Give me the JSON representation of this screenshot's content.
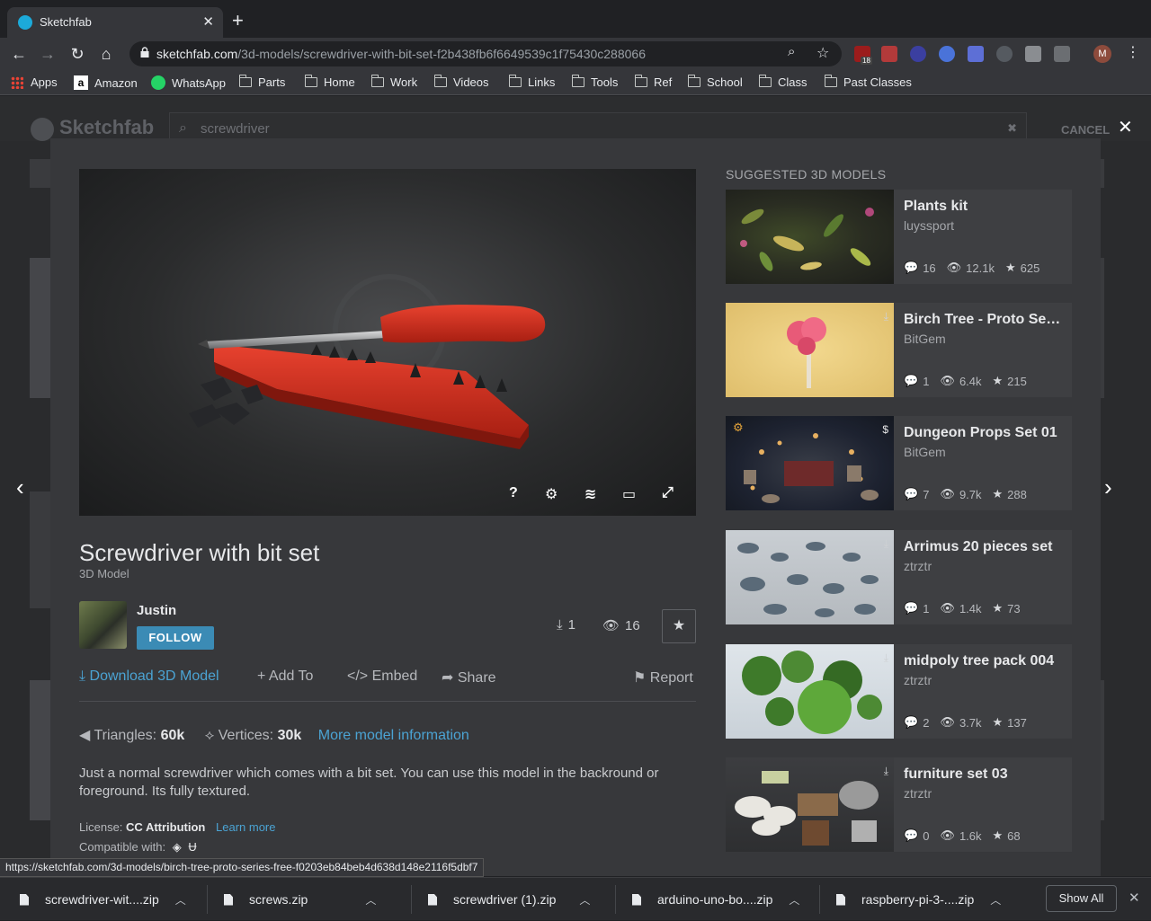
{
  "browser": {
    "tab_title": "Sketchfab",
    "tab_close": "✕",
    "new_tab": "+",
    "url_host": "sketchfab.com",
    "url_path": "/3d-models/screwdriver-with-bit-set-f2b438fb6f6649539c1f75430c288066",
    "profile_initial": "M",
    "ext_badge": "18",
    "bookmarks": [
      "Apps",
      "Amazon",
      "WhatsApp",
      "Parts",
      "Home",
      "Work",
      "Videos",
      "Links",
      "Tools",
      "Ref",
      "School",
      "Class",
      "Past Classes"
    ]
  },
  "background_page": {
    "logo": "Sketchfab",
    "search_value": "screwdriver",
    "cancel": "CANCEL"
  },
  "model": {
    "title": "Screwdriver with bit set",
    "subtitle": "3D Model",
    "author": "Justin",
    "follow": "FOLLOW",
    "downloads": "1",
    "views": "16",
    "actions": {
      "download": "Download 3D Model",
      "add_to": "Add To",
      "embed": "Embed",
      "share": "Share",
      "report": "Report"
    },
    "triangles_label": "Triangles:",
    "triangles": "60k",
    "vertices_label": "Vertices:",
    "vertices": "30k",
    "more_info": "More model information",
    "description": "Just a normal screwdriver which comes with a bit set. You can use this model in the backround or foreground. Its fully textured.",
    "license_label": "License:",
    "license": "CC Attribution",
    "learn_more": "Learn more",
    "compatible_label": "Compatible with:"
  },
  "viewer_controls": [
    "?",
    "⚙",
    "≋",
    "▭",
    "⤢"
  ],
  "suggested": {
    "heading": "SUGGESTED 3D MODELS",
    "items": [
      {
        "name": "Plants kit",
        "author": "luyssport",
        "comments": "16",
        "views": "12.1k",
        "likes": "625"
      },
      {
        "name": "Birch Tree - Proto Seri...",
        "author": "BitGem",
        "comments": "1",
        "views": "6.4k",
        "likes": "215"
      },
      {
        "name": "Dungeon Props Set 01",
        "author": "BitGem",
        "comments": "7",
        "views": "9.7k",
        "likes": "288"
      },
      {
        "name": "Arrimus 20 pieces set",
        "author": "ztrztr",
        "comments": "1",
        "views": "1.4k",
        "likes": "73"
      },
      {
        "name": "midpoly tree pack 004",
        "author": "ztrztr",
        "comments": "2",
        "views": "3.7k",
        "likes": "137"
      },
      {
        "name": "furniture set 03",
        "author": "ztrztr",
        "comments": "0",
        "views": "1.6k",
        "likes": "68"
      }
    ]
  },
  "status_url": "https://sketchfab.com/3d-models/birch-tree-proto-series-free-f0203eb84beb4d638d148e2116f5dbf7",
  "downloads_shelf": {
    "files": [
      "screwdriver-wit....zip",
      "screws.zip",
      "screwdriver (1).zip",
      "arduino-uno-bo....zip",
      "raspberry-pi-3-....zip"
    ],
    "show_all": "Show All"
  },
  "colors": {
    "accent": "#4ba3d3",
    "follow_button": "#3b8bb5",
    "model_red": "#d3301f"
  }
}
